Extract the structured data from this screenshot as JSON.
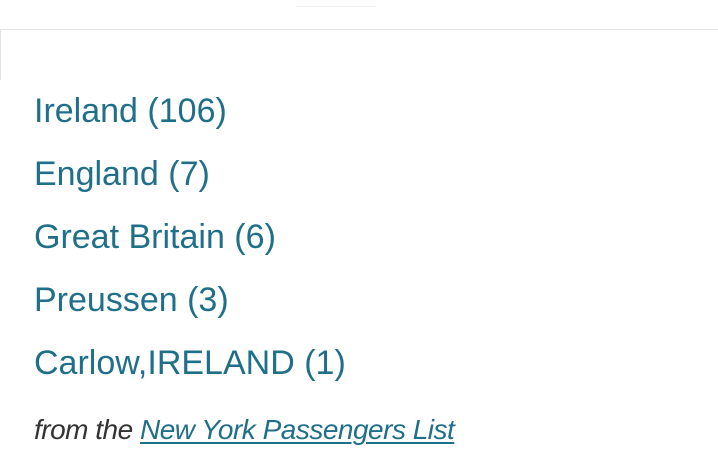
{
  "origins": {
    "items": [
      {
        "label": "Ireland",
        "count": "106"
      },
      {
        "label": "England",
        "count": "7"
      },
      {
        "label": "Great Britain",
        "count": "6"
      },
      {
        "label": "Preussen",
        "count": "3"
      },
      {
        "label": "Carlow,IRELAND",
        "count": "1"
      }
    ]
  },
  "source": {
    "prefix": "from the",
    "link_text": "New York Passengers List"
  },
  "colors": {
    "link": "#1f6f8b",
    "text": "#333333",
    "background": "#ffffff"
  }
}
